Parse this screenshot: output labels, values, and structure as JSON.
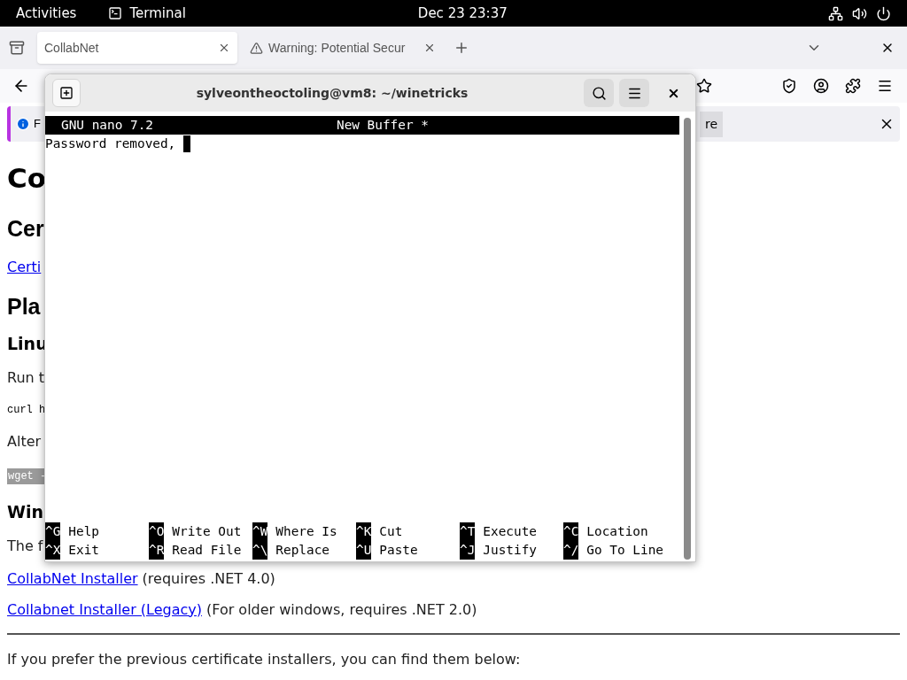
{
  "top_bar": {
    "activities": "Activities",
    "app_name": "Terminal",
    "clock": "Dec 23  23:37"
  },
  "browser": {
    "tabs": [
      {
        "title": "CollabNet",
        "selected": true,
        "kind": "page"
      },
      {
        "title": "Warning: Potential Secur",
        "selected": false,
        "kind": "warning"
      }
    ],
    "notification": {
      "text": "F",
      "button": "re"
    },
    "page": [
      {
        "kind": "h1",
        "text": "Co"
      },
      {
        "kind": "h2",
        "text": "Cer"
      },
      {
        "kind": "link",
        "text": "Certi"
      },
      {
        "kind": "h2",
        "text": "Pla"
      },
      {
        "kind": "h3",
        "text": "Linu"
      },
      {
        "kind": "p",
        "text": "Run t"
      },
      {
        "kind": "code",
        "text": "curl h"
      },
      {
        "kind": "p",
        "text": "Alter"
      },
      {
        "kind": "code_selected",
        "text": "wget -"
      },
      {
        "kind": "h3",
        "text": "Win"
      },
      {
        "kind": "p",
        "text": "The f"
      },
      {
        "kind": "link_note",
        "link": "CollabNet Installer",
        "note": "(requires .NET 4.0)"
      },
      {
        "kind": "link_note",
        "link": "Collabnet Installer (Legacy)",
        "note": "(For older windows, requires .NET 2.0)"
      },
      {
        "kind": "rule"
      },
      {
        "kind": "p",
        "text": "If you prefer the previous certificate installers, you can find them below:"
      }
    ]
  },
  "terminal": {
    "title": "sylveontheoctoling@vm8: ~/winetricks",
    "nano": {
      "version": "GNU nano 7.2",
      "buffer": "New Buffer *",
      "lines": [
        "Password removed, "
      ],
      "shortcut_rows": [
        [
          {
            "key": "^G",
            "label": "Help"
          },
          {
            "key": "^O",
            "label": "Write Out"
          },
          {
            "key": "^W",
            "label": "Where Is"
          },
          {
            "key": "^K",
            "label": "Cut"
          },
          {
            "key": "^T",
            "label": "Execute"
          },
          {
            "key": "^C",
            "label": "Location"
          }
        ],
        [
          {
            "key": "^X",
            "label": "Exit"
          },
          {
            "key": "^R",
            "label": "Read File"
          },
          {
            "key": "^\\",
            "label": "Replace"
          },
          {
            "key": "^U",
            "label": "Paste"
          },
          {
            "key": "^J",
            "label": "Justify"
          },
          {
            "key": "^/",
            "label": "Go To Line"
          }
        ]
      ]
    }
  }
}
